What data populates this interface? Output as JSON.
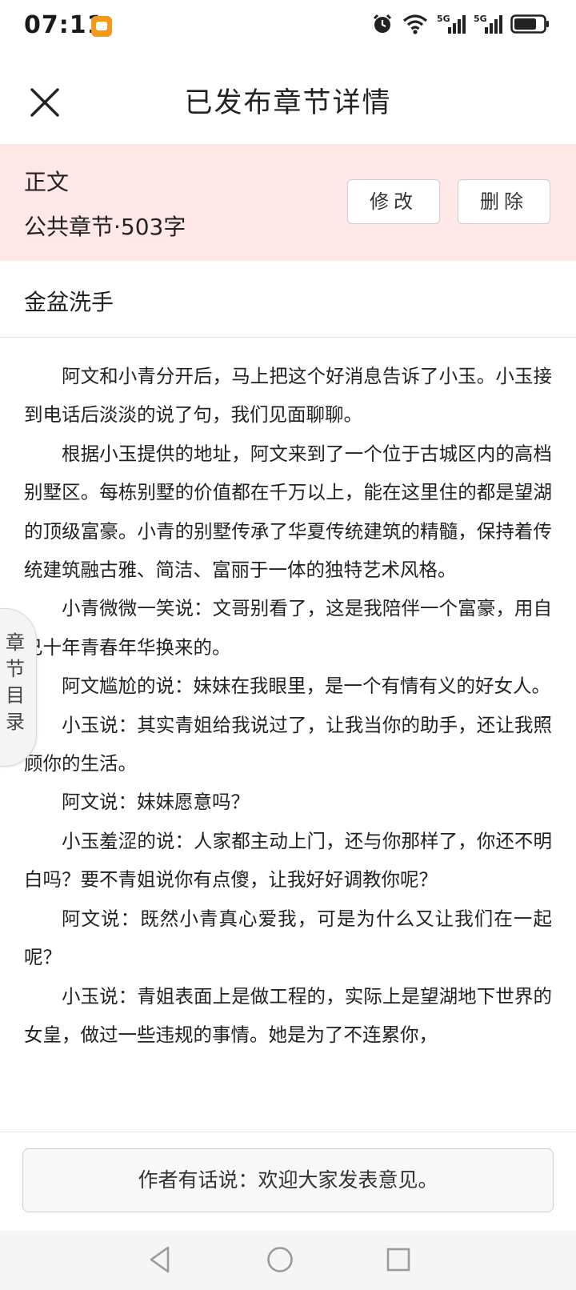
{
  "status_bar": {
    "time": "07:11",
    "icons": [
      "app-notification-icon",
      "alarm-icon",
      "wifi-icon",
      "signal-5g-icon",
      "signal-5g-icon",
      "battery-icon"
    ],
    "signal_labels": [
      "5G",
      "5G"
    ]
  },
  "header": {
    "close_icon": "close-icon",
    "title": "已发布章节详情"
  },
  "chapter_info": {
    "category": "正文",
    "meta": "公共章节·503字",
    "edit_label": "修改",
    "delete_label": "删除"
  },
  "chapter": {
    "title": "金盆洗手"
  },
  "content": {
    "paragraphs": [
      "阿文和小青分开后，马上把这个好消息告诉了小玉。小玉接到电话后淡淡的说了句，我们见面聊聊。",
      "根据小玉提供的地址，阿文来到了一个位于古城区内的高档别墅区。每栋别墅的价值都在千万以上，能在这里住的都是望湖的顶级富豪。小青的别墅传承了华夏传统建筑的精髓，保持着传统建筑融古雅、简洁、富丽于一体的独特艺术风格。",
      "小青微微一笑说：文哥别看了，这是我陪伴一个富豪，用自己十年青春年华换来的。",
      "阿文尴尬的说：妹妹在我眼里，是一个有情有义的好女人。",
      "小玉说：其实青姐给我说过了，让我当你的助手，还让我照顾你的生活。",
      "阿文说：妹妹愿意吗？",
      "小玉羞涩的说：人家都主动上门，还与你那样了，你还不明白吗？要不青姐说你有点傻，让我好好调教你呢？",
      "阿文说：既然小青真心爱我，可是为什么又让我们在一起呢？",
      "小玉说：青姐表面上是做工程的，实际上是望湖地下世界的女皇，做过一些违规的事情。她是为了不连累你，"
    ]
  },
  "side_tab": {
    "label": "章节目录"
  },
  "footer": {
    "author_note": "作者有话说：欢迎大家发表意见。"
  },
  "nav_bar": {
    "icons": [
      "back-triangle-icon",
      "home-circle-icon",
      "recents-square-icon"
    ]
  }
}
